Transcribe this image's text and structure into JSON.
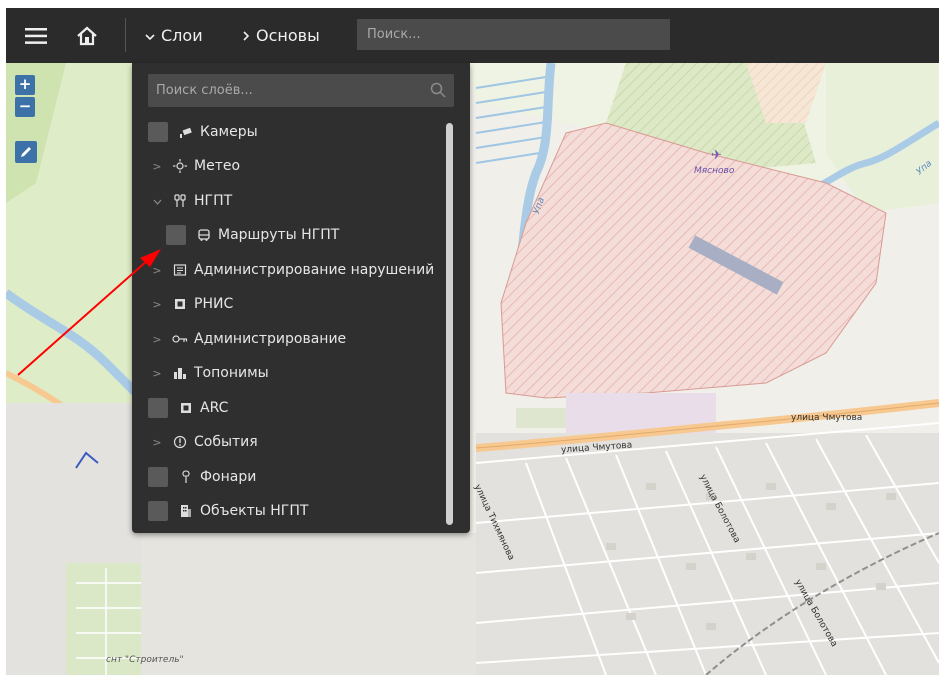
{
  "topbar": {
    "nav_layers": "Слои",
    "nav_basics": "Основы",
    "search_placeholder": "Поиск..."
  },
  "layers_panel": {
    "search_placeholder": "Поиск слоёв...",
    "items": [
      {
        "label": "Камеры",
        "icon": "camera-icon",
        "checkbox": true,
        "expander": "none",
        "indent": 0
      },
      {
        "label": "Метео",
        "icon": "weather-icon",
        "checkbox": false,
        "expander": "collapsed",
        "indent": 0
      },
      {
        "label": "НГПТ",
        "icon": "transit-icon",
        "checkbox": false,
        "expander": "expanded",
        "indent": 0
      },
      {
        "label": "Маршруты НГПТ",
        "icon": "bus-icon",
        "checkbox": true,
        "expander": "none",
        "indent": 1
      },
      {
        "label": "Администрирование нарушений",
        "icon": "violations-icon",
        "checkbox": false,
        "expander": "collapsed",
        "indent": 0
      },
      {
        "label": "РНИС",
        "icon": "rnis-icon",
        "checkbox": false,
        "expander": "collapsed",
        "indent": 0
      },
      {
        "label": "Администрирование",
        "icon": "keys-icon",
        "checkbox": false,
        "expander": "collapsed",
        "indent": 0
      },
      {
        "label": "Топонимы",
        "icon": "city-icon",
        "checkbox": false,
        "expander": "collapsed",
        "indent": 0
      },
      {
        "label": "ARC",
        "icon": "arc-icon",
        "checkbox": true,
        "expander": "none",
        "indent": 0
      },
      {
        "label": "События",
        "icon": "event-icon",
        "checkbox": false,
        "expander": "collapsed",
        "indent": 0
      },
      {
        "label": "Фонари",
        "icon": "streetlight-icon",
        "checkbox": true,
        "expander": "none",
        "indent": 0
      },
      {
        "label": "Объекты НГПТ",
        "icon": "building-icon",
        "checkbox": true,
        "expander": "none",
        "indent": 0
      }
    ]
  },
  "map": {
    "labels": {
      "myasnovo": "Мясново",
      "chmutova_1": "улица Чмутова",
      "chmutova_2": "улица Чмутова",
      "bolotova_1": "улица Болотова",
      "bolotova_2": "улица Болотова",
      "tikhmyanova": "улица Тихмянова",
      "upa_1": "Упа",
      "upa_2": "Упа",
      "snt": "снт \"Строитель\""
    },
    "zoom_in": "+",
    "zoom_out": "−"
  },
  "colors": {
    "topbar": "#2b2b2b",
    "panel": "#2f2f2f",
    "map_button": "#3d72a8",
    "arrow": "#ff0000",
    "airfield_fill": "#f3d7d4"
  }
}
